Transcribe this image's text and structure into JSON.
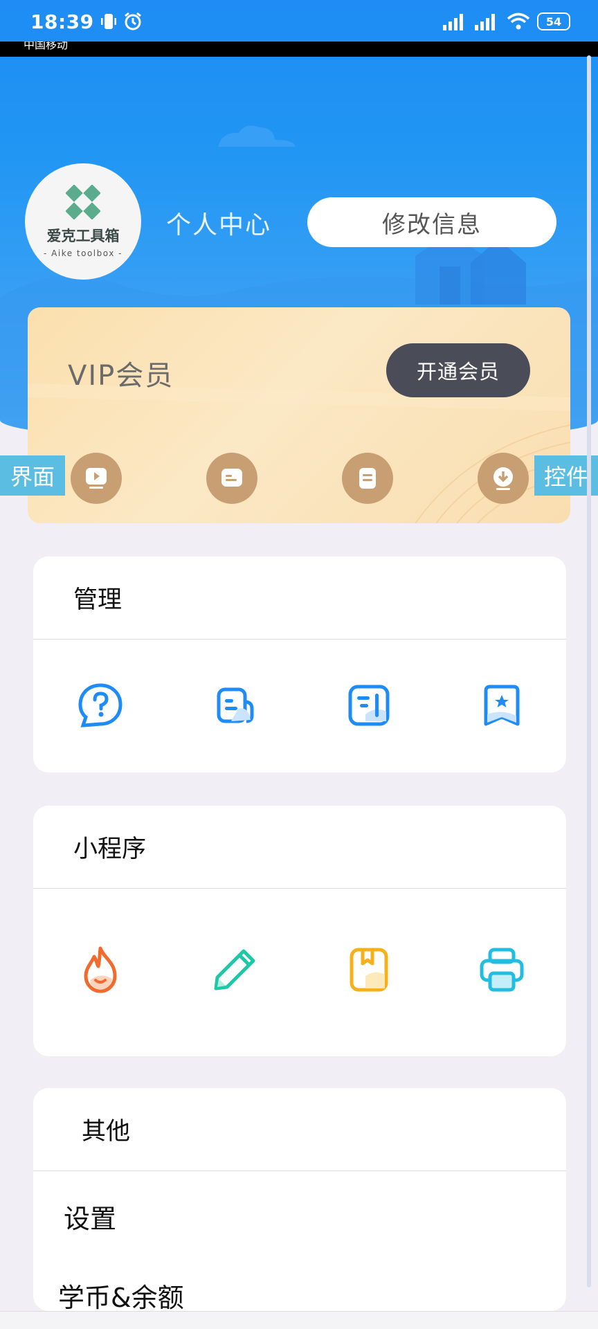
{
  "status_bar": {
    "time": "18:39",
    "battery": "54",
    "carrier": "中国移动"
  },
  "profile": {
    "logo_title": "爱克工具箱",
    "logo_subtitle": "- Aike toolbox -",
    "page_title": "个人中心",
    "edit_button": "修改信息"
  },
  "vip": {
    "title": "VIP会员",
    "button": "开通会员",
    "icons": [
      "play-screen-icon",
      "message-card-icon",
      "document-icon",
      "download-icon"
    ],
    "accent_color": "#c89f72"
  },
  "side_tags": {
    "left": "界面",
    "right": "控件"
  },
  "manage": {
    "title": "管理",
    "icons": [
      "help-bubble-icon",
      "notes-icon",
      "report-icon",
      "bookmark-star-icon"
    ],
    "color": "#1e8cf4"
  },
  "mini_programs": {
    "title": "小程序",
    "icons": [
      "flame-icon",
      "pencil-icon",
      "book-icon",
      "printer-icon"
    ]
  },
  "other": {
    "title": "其他",
    "items": [
      "设置",
      "学币&余额"
    ]
  },
  "colors": {
    "header_blue": "#2196f3",
    "background": "#f2eef5",
    "vip_gold": "#fbe0ae",
    "vip_button": "#4a4d57",
    "tag_blue": "#5bbde1"
  }
}
